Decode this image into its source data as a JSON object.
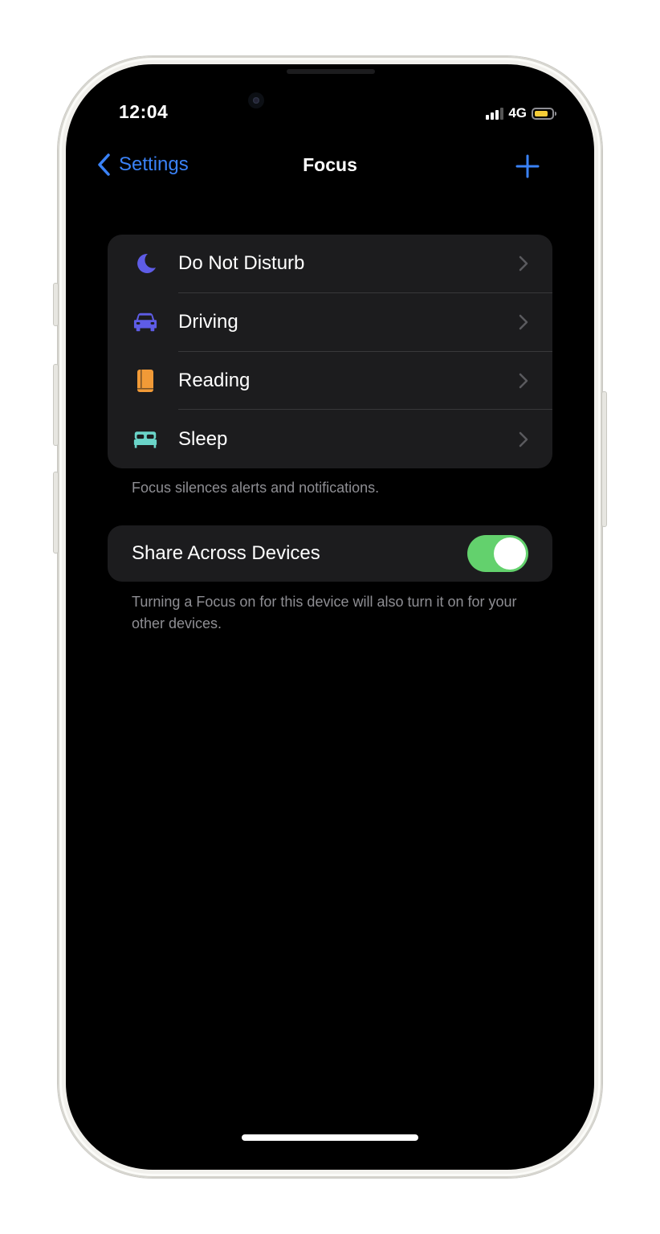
{
  "status_bar": {
    "time": "12:04",
    "network": "4G",
    "signal_bars_active": 3,
    "battery_color": "#f5cc37"
  },
  "nav": {
    "back_label": "Settings",
    "title": "Focus",
    "add_icon": "plus-icon",
    "accent_color": "#3a82f7"
  },
  "focus_modes": [
    {
      "label": "Do Not Disturb",
      "icon": "moon-icon",
      "color": "#5e5ce6"
    },
    {
      "label": "Driving",
      "icon": "car-icon",
      "color": "#5e5ce6"
    },
    {
      "label": "Reading",
      "icon": "book-icon",
      "color": "#f19a37"
    },
    {
      "label": "Sleep",
      "icon": "bed-icon",
      "color": "#6ad4c8"
    }
  ],
  "focus_footer": "Focus silences alerts and notifications.",
  "share": {
    "label": "Share Across Devices",
    "enabled": true,
    "toggle_color": "#63d16d",
    "footer": "Turning a Focus on for this device will also turn it on for your other devices."
  }
}
